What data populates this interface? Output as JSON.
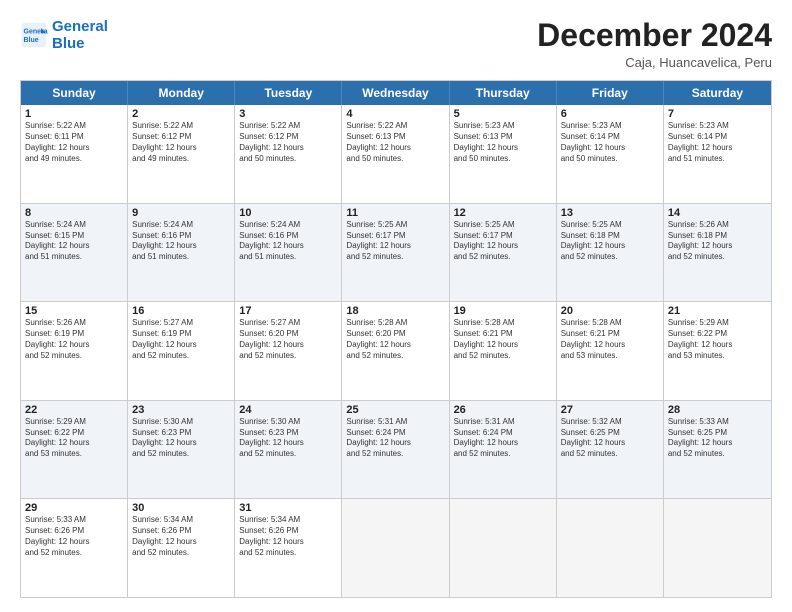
{
  "logo": {
    "line1": "General",
    "line2": "Blue"
  },
  "header": {
    "month": "December 2024",
    "location": "Caja, Huancavelica, Peru"
  },
  "days_of_week": [
    "Sunday",
    "Monday",
    "Tuesday",
    "Wednesday",
    "Thursday",
    "Friday",
    "Saturday"
  ],
  "rows": [
    [
      {
        "day": "",
        "info": "",
        "empty": true
      },
      {
        "day": "2",
        "info": "Sunrise: 5:22 AM\nSunset: 6:12 PM\nDaylight: 12 hours\nand 49 minutes.",
        "empty": false
      },
      {
        "day": "3",
        "info": "Sunrise: 5:22 AM\nSunset: 6:12 PM\nDaylight: 12 hours\nand 50 minutes.",
        "empty": false
      },
      {
        "day": "4",
        "info": "Sunrise: 5:22 AM\nSunset: 6:13 PM\nDaylight: 12 hours\nand 50 minutes.",
        "empty": false
      },
      {
        "day": "5",
        "info": "Sunrise: 5:23 AM\nSunset: 6:13 PM\nDaylight: 12 hours\nand 50 minutes.",
        "empty": false
      },
      {
        "day": "6",
        "info": "Sunrise: 5:23 AM\nSunset: 6:14 PM\nDaylight: 12 hours\nand 50 minutes.",
        "empty": false
      },
      {
        "day": "7",
        "info": "Sunrise: 5:23 AM\nSunset: 6:14 PM\nDaylight: 12 hours\nand 51 minutes.",
        "empty": false
      }
    ],
    [
      {
        "day": "1",
        "info": "Sunrise: 5:22 AM\nSunset: 6:11 PM\nDaylight: 12 hours\nand 49 minutes.",
        "empty": false
      },
      {
        "day": "9",
        "info": "Sunrise: 5:24 AM\nSunset: 6:16 PM\nDaylight: 12 hours\nand 51 minutes.",
        "empty": false
      },
      {
        "day": "10",
        "info": "Sunrise: 5:24 AM\nSunset: 6:16 PM\nDaylight: 12 hours\nand 51 minutes.",
        "empty": false
      },
      {
        "day": "11",
        "info": "Sunrise: 5:25 AM\nSunset: 6:17 PM\nDaylight: 12 hours\nand 52 minutes.",
        "empty": false
      },
      {
        "day": "12",
        "info": "Sunrise: 5:25 AM\nSunset: 6:17 PM\nDaylight: 12 hours\nand 52 minutes.",
        "empty": false
      },
      {
        "day": "13",
        "info": "Sunrise: 5:25 AM\nSunset: 6:18 PM\nDaylight: 12 hours\nand 52 minutes.",
        "empty": false
      },
      {
        "day": "14",
        "info": "Sunrise: 5:26 AM\nSunset: 6:18 PM\nDaylight: 12 hours\nand 52 minutes.",
        "empty": false
      }
    ],
    [
      {
        "day": "8",
        "info": "Sunrise: 5:24 AM\nSunset: 6:15 PM\nDaylight: 12 hours\nand 51 minutes.",
        "empty": false
      },
      {
        "day": "16",
        "info": "Sunrise: 5:27 AM\nSunset: 6:19 PM\nDaylight: 12 hours\nand 52 minutes.",
        "empty": false
      },
      {
        "day": "17",
        "info": "Sunrise: 5:27 AM\nSunset: 6:20 PM\nDaylight: 12 hours\nand 52 minutes.",
        "empty": false
      },
      {
        "day": "18",
        "info": "Sunrise: 5:28 AM\nSunset: 6:20 PM\nDaylight: 12 hours\nand 52 minutes.",
        "empty": false
      },
      {
        "day": "19",
        "info": "Sunrise: 5:28 AM\nSunset: 6:21 PM\nDaylight: 12 hours\nand 52 minutes.",
        "empty": false
      },
      {
        "day": "20",
        "info": "Sunrise: 5:28 AM\nSunset: 6:21 PM\nDaylight: 12 hours\nand 53 minutes.",
        "empty": false
      },
      {
        "day": "21",
        "info": "Sunrise: 5:29 AM\nSunset: 6:22 PM\nDaylight: 12 hours\nand 53 minutes.",
        "empty": false
      }
    ],
    [
      {
        "day": "15",
        "info": "Sunrise: 5:26 AM\nSunset: 6:19 PM\nDaylight: 12 hours\nand 52 minutes.",
        "empty": false
      },
      {
        "day": "23",
        "info": "Sunrise: 5:30 AM\nSunset: 6:23 PM\nDaylight: 12 hours\nand 52 minutes.",
        "empty": false
      },
      {
        "day": "24",
        "info": "Sunrise: 5:30 AM\nSunset: 6:23 PM\nDaylight: 12 hours\nand 52 minutes.",
        "empty": false
      },
      {
        "day": "25",
        "info": "Sunrise: 5:31 AM\nSunset: 6:24 PM\nDaylight: 12 hours\nand 52 minutes.",
        "empty": false
      },
      {
        "day": "26",
        "info": "Sunrise: 5:31 AM\nSunset: 6:24 PM\nDaylight: 12 hours\nand 52 minutes.",
        "empty": false
      },
      {
        "day": "27",
        "info": "Sunrise: 5:32 AM\nSunset: 6:25 PM\nDaylight: 12 hours\nand 52 minutes.",
        "empty": false
      },
      {
        "day": "28",
        "info": "Sunrise: 5:33 AM\nSunset: 6:25 PM\nDaylight: 12 hours\nand 52 minutes.",
        "empty": false
      }
    ],
    [
      {
        "day": "22",
        "info": "Sunrise: 5:29 AM\nSunset: 6:22 PM\nDaylight: 12 hours\nand 53 minutes.",
        "empty": false
      },
      {
        "day": "30",
        "info": "Sunrise: 5:34 AM\nSunset: 6:26 PM\nDaylight: 12 hours\nand 52 minutes.",
        "empty": false
      },
      {
        "day": "31",
        "info": "Sunrise: 5:34 AM\nSunset: 6:26 PM\nDaylight: 12 hours\nand 52 minutes.",
        "empty": false
      },
      {
        "day": "",
        "info": "",
        "empty": true
      },
      {
        "day": "",
        "info": "",
        "empty": true
      },
      {
        "day": "",
        "info": "",
        "empty": true
      },
      {
        "day": "",
        "info": "",
        "empty": true
      }
    ],
    [
      {
        "day": "29",
        "info": "Sunrise: 5:33 AM\nSunset: 6:26 PM\nDaylight: 12 hours\nand 52 minutes.",
        "empty": false
      },
      {
        "day": "",
        "info": "",
        "empty": true
      },
      {
        "day": "",
        "info": "",
        "empty": true
      },
      {
        "day": "",
        "info": "",
        "empty": true
      },
      {
        "day": "",
        "info": "",
        "empty": true
      },
      {
        "day": "",
        "info": "",
        "empty": true
      },
      {
        "day": "",
        "info": "",
        "empty": true
      }
    ]
  ],
  "row_order": [
    [
      0,
      1,
      2,
      3,
      4,
      5,
      6
    ],
    [
      0,
      1,
      2,
      3,
      4,
      5,
      6
    ],
    [
      0,
      1,
      2,
      3,
      4,
      5,
      6
    ],
    [
      0,
      1,
      2,
      3,
      4,
      5,
      6
    ],
    [
      0,
      1,
      2,
      3,
      4,
      5,
      6
    ],
    [
      0,
      1,
      2,
      3,
      4,
      5,
      6
    ]
  ]
}
